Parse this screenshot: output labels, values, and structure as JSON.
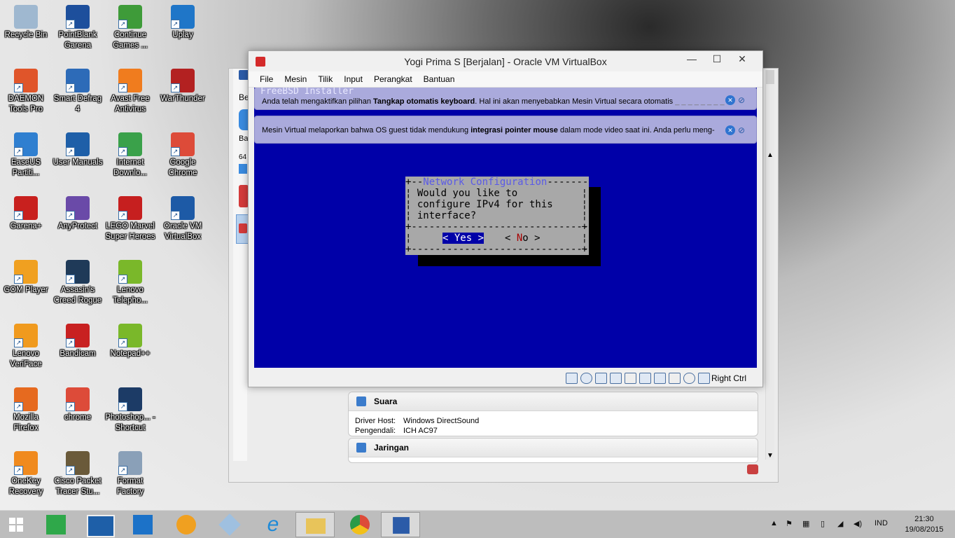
{
  "desktop": {
    "icons": [
      {
        "label": "Recycle Bin",
        "icon": "recycle-bin-icon",
        "color": "#9fb8d0"
      },
      {
        "label": "PointBlank Garena",
        "icon": "pointblank-icon",
        "color": "#1d4f9c"
      },
      {
        "label": "Continue Games ...",
        "icon": "continue-games-icon",
        "color": "#3e9b39"
      },
      {
        "label": "Uplay",
        "icon": "uplay-icon",
        "color": "#1f76c8"
      },
      {
        "label": "DAEMON Tools Pro",
        "icon": "daemon-tools-icon",
        "color": "#e0552a"
      },
      {
        "label": "Smart Defrag 4",
        "icon": "smart-defrag-icon",
        "color": "#2d6bb8"
      },
      {
        "label": "Avast Free Antivirus",
        "icon": "avast-icon",
        "color": "#f07c1e"
      },
      {
        "label": "WarThunder",
        "icon": "warthunder-icon",
        "color": "#b32121"
      },
      {
        "label": "EaseUS Partiti...",
        "icon": "easeus-icon",
        "color": "#2f7fd0"
      },
      {
        "label": "User Manuals",
        "icon": "user-manuals-icon",
        "color": "#1e5fa8"
      },
      {
        "label": "Internet Downlo...",
        "icon": "internet-download-icon",
        "color": "#3aa14a"
      },
      {
        "label": "Google Chrome",
        "icon": "chrome-icon",
        "color": "#dd4b39"
      },
      {
        "label": "Garena+",
        "icon": "garena-icon",
        "color": "#c8201e"
      },
      {
        "label": "AnyProtect",
        "icon": "anyprotect-icon",
        "color": "#6a4aa8"
      },
      {
        "label": "LEGO Marvel Super Heroes",
        "icon": "lego-marvel-icon",
        "color": "#c61f1f"
      },
      {
        "label": "Oracle VM VirtualBox",
        "icon": "virtualbox-icon",
        "color": "#1d5aa6"
      },
      {
        "label": "GOM Player",
        "icon": "gom-player-icon",
        "color": "#f0a020"
      },
      {
        "label": "Assasin's Creed Rogue",
        "icon": "assassins-creed-icon",
        "color": "#1f3a58"
      },
      {
        "label": "Lenovo Telepho...",
        "icon": "lenovo-telephony-icon",
        "color": "#7ab82a"
      },
      {
        "label": "Lenovo VeriFace",
        "icon": "lenovo-veriface-icon",
        "color": "#f09a1e"
      },
      {
        "label": "Bandicam",
        "icon": "bandicam-icon",
        "color": "#c82121"
      },
      {
        "label": "Notepad++",
        "icon": "notepadpp-icon",
        "color": "#7ab82a"
      },
      {
        "label": "Mozilla Firefox",
        "icon": "firefox-icon",
        "color": "#e66a1f"
      },
      {
        "label": "chrome",
        "icon": "chrome-icon",
        "color": "#dd4b39"
      },
      {
        "label": "Photoshop... - Shortcut",
        "icon": "photoshop-icon",
        "color": "#1c3b66"
      },
      {
        "label": "OneKey Recovery",
        "icon": "onekey-recovery-icon",
        "color": "#f08a1e"
      },
      {
        "label": "Cisco Packet Tracer Stu...",
        "icon": "cisco-packet-tracer-icon",
        "color": "#6a5a3a"
      },
      {
        "label": "Format Factory",
        "icon": "format-factory-icon",
        "color": "#8aa0b8"
      }
    ]
  },
  "manager": {
    "sections": [
      {
        "title": "Suara",
        "rows": [
          {
            "key": "Driver Host:",
            "value": "Windows DirectSound"
          },
          {
            "key": "Pengendali:",
            "value": "ICH AC97"
          }
        ]
      },
      {
        "title": "Jaringan",
        "rows": []
      }
    ],
    "left_tab_text": "Be",
    "left_tab_text2": "Ba",
    "left_item_text": "64"
  },
  "vm_window": {
    "title": "Yogi Prima S [Berjalan] - Oracle VM VirtualBox",
    "controls": {
      "minimize": "—",
      "maximize": "☐",
      "close": "✕"
    },
    "menu": [
      "File",
      "Mesin",
      "Tilik",
      "Input",
      "Perangkat",
      "Bantuan"
    ],
    "notice1": {
      "header": "FreeBSD Installer",
      "pre": "Anda telah mengaktifkan pilihan ",
      "bold": "Tangkap otomatis keyboard",
      "post": ". Hal ini akan menyebabkan Mesin Virtual secara otomatis"
    },
    "notice2": {
      "pre": "Mesin Virtual melaporkan bahwa OS guest tidak mendukung ",
      "bold": "integrasi pointer mouse",
      "post": " dalam mode video saat ini. Anda perlu meng-"
    },
    "dialog": {
      "title": "Network Configuration",
      "lines": [
        "Would you like to",
        "configure IPv4 for this",
        "interface?"
      ],
      "yes_label": "< Yes >",
      "no_left": "< ",
      "no_first": "N",
      "no_rest": "o",
      "no_right": " >",
      "selected": "Yes"
    },
    "host_key": "Right Ctrl",
    "colors": {
      "guest_bg": "#0000a8",
      "dialog_bg": "#a8a8a8",
      "accent_red": "#a80000"
    }
  },
  "taskbar": {
    "apps": [
      "start-icon",
      "store-icon",
      "lenovo-icon",
      "maxthon-icon",
      "gom-icon",
      "psp-icon",
      "ie-icon",
      "explorer-icon",
      "chrome-icon",
      "virtualbox-icon"
    ],
    "language": "IND",
    "time": "21:30",
    "date": "19/08/2015"
  }
}
